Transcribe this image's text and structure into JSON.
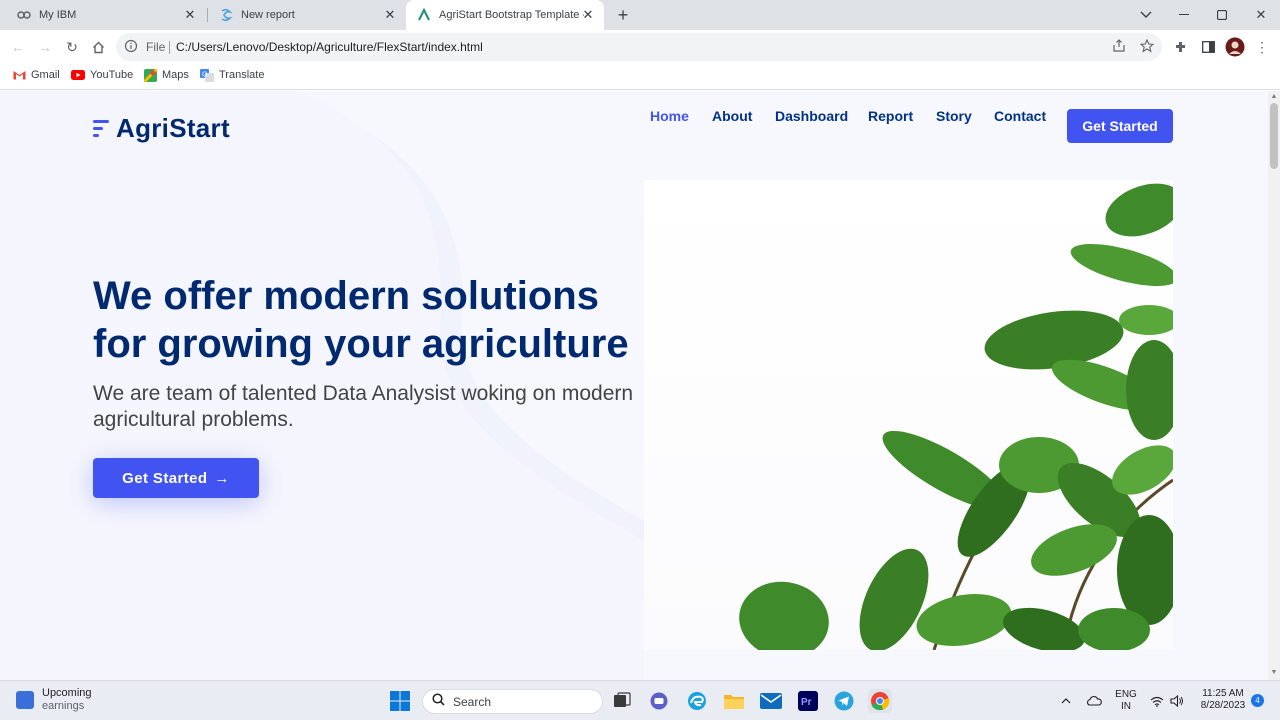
{
  "browser": {
    "tabs": [
      {
        "title": "My IBM",
        "active": false
      },
      {
        "title": "New report",
        "active": false
      },
      {
        "title": "AgriStart Bootstrap Template - In",
        "active": true
      }
    ],
    "address": {
      "scheme_label": "File",
      "url": "C:/Users/Lenovo/Desktop/Agriculture/FlexStart/index.html"
    },
    "bookmarks": [
      "Gmail",
      "YouTube",
      "Maps",
      "Translate"
    ]
  },
  "site": {
    "logo": "AgriStart",
    "nav": [
      {
        "label": "Home",
        "active": true
      },
      {
        "label": "About",
        "active": false
      },
      {
        "label": "Dashboard",
        "active": false
      },
      {
        "label": "Report",
        "active": false
      },
      {
        "label": "Story",
        "active": false
      },
      {
        "label": "Contact",
        "active": false
      }
    ],
    "nav_cta": "Get Started",
    "hero": {
      "title": "We offer modern solutions for growing your agriculture",
      "subtitle": "We are team of talented Data Analysist woking on modern agricultural problems.",
      "button": "Get Started"
    },
    "colors": {
      "primary": "#4154f1",
      "heading": "#012970",
      "background": "#f7f8fd"
    }
  },
  "taskbar": {
    "weather": {
      "title": "Upcoming",
      "subtitle": "earnings"
    },
    "search_label": "Search",
    "language": {
      "line1": "ENG",
      "line2": "IN"
    },
    "time": "11:25 AM",
    "date": "8/28/2023",
    "notification_count": "4"
  }
}
